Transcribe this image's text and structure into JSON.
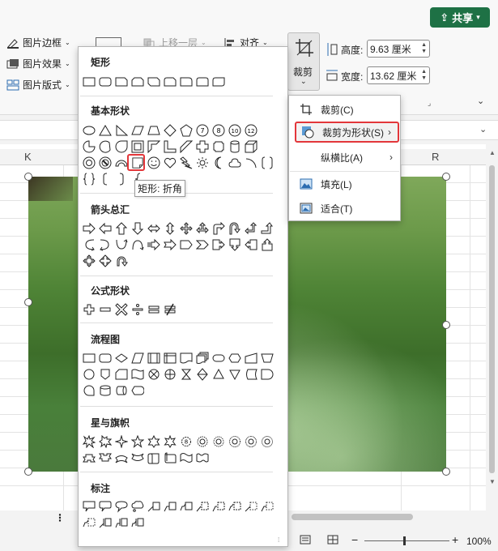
{
  "ribbon": {
    "share_label": "共享",
    "picture_border": "图片边框",
    "picture_effects": "图片效果",
    "picture_layout": "图片版式",
    "bring_forward": "上移一层",
    "align": "对齐",
    "crop_label": "裁剪",
    "height_label": "高度:",
    "height_value": "9.63 厘米",
    "width_label": "宽度:",
    "width_value": "13.62 厘米"
  },
  "sheet": {
    "col_k": "K",
    "col_r": "R"
  },
  "shapes_panel": {
    "categories": [
      {
        "title": "矩形"
      },
      {
        "title": "基本形状"
      },
      {
        "title": "箭头总汇"
      },
      {
        "title": "公式形状"
      },
      {
        "title": "流程图"
      },
      {
        "title": "星与旗帜"
      },
      {
        "title": "标注"
      }
    ],
    "tooltip": "矩形: 折角"
  },
  "crop_menu": {
    "items": [
      {
        "label": "裁剪(C)",
        "icon": "crop-icon"
      },
      {
        "label": "裁剪为形状(S)",
        "icon": "crop-to-shape-icon",
        "submenu": true,
        "highlighted": true
      },
      {
        "label": "纵横比(A)",
        "icon": "",
        "submenu": true
      },
      {
        "label": "填充(L)",
        "icon": "fill-icon"
      },
      {
        "label": "适合(T)",
        "icon": "fit-icon"
      }
    ]
  },
  "statusbar": {
    "zoom": "100%"
  },
  "colors": {
    "share_green": "#1e7145",
    "highlight_red": "#e3363a"
  }
}
